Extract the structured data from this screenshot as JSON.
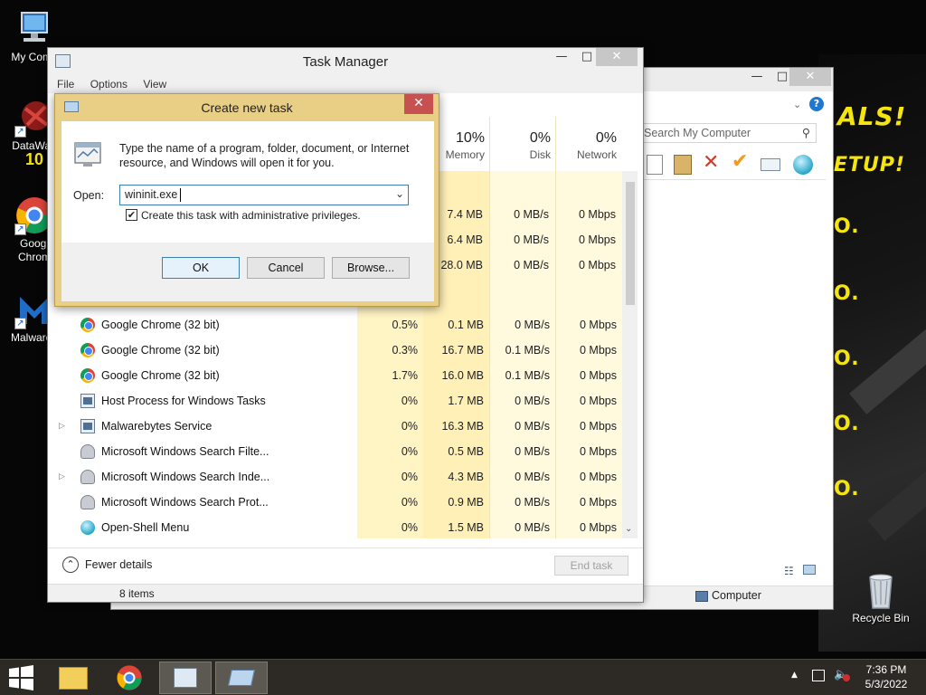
{
  "desktop": {
    "icons": [
      {
        "label": "My Comp"
      },
      {
        "label": "DataWag",
        "sublabel": "10"
      },
      {
        "label": "Googl",
        "sublabel": "Chrom"
      },
      {
        "label": "Malwareb"
      },
      {
        "label": "Recycle Bin"
      }
    ],
    "promo": {
      "deals": "ALS!",
      "setup": "ETUP!",
      "dot": "O."
    }
  },
  "computer_window": {
    "search_placeholder": "Search My Computer",
    "status_item": "Computer",
    "help": "?"
  },
  "task_manager": {
    "title": "Task Manager",
    "menu": [
      "File",
      "Options",
      "View"
    ],
    "columns": [
      {
        "pct": "10%",
        "name": "Memory"
      },
      {
        "pct": "0%",
        "name": "Disk"
      },
      {
        "pct": "0%",
        "name": "Network"
      }
    ],
    "hidden_rows": [
      {
        "mem": "7.4 MB",
        "disk": "0 MB/s",
        "net": "0 Mbps"
      },
      {
        "mem": "6.4 MB",
        "disk": "0 MB/s",
        "net": "0 Mbps"
      },
      {
        "mem": "28.0 MB",
        "disk": "0 MB/s",
        "net": "0 Mbps"
      }
    ],
    "processes": [
      {
        "name": "Google Chrome (32 bit)",
        "icon": "chrome-icon",
        "expand": false,
        "cpu": "0.5%",
        "mem": "0.1 MB",
        "disk": "0 MB/s",
        "net": "0 Mbps"
      },
      {
        "name": "Google Chrome (32 bit)",
        "icon": "chrome-icon",
        "expand": false,
        "cpu": "0.3%",
        "mem": "16.7 MB",
        "disk": "0.1 MB/s",
        "net": "0 Mbps"
      },
      {
        "name": "Google Chrome (32 bit)",
        "icon": "chrome-icon",
        "expand": false,
        "cpu": "1.7%",
        "mem": "16.0 MB",
        "disk": "0.1 MB/s",
        "net": "0 Mbps"
      },
      {
        "name": "Host Process for Windows Tasks",
        "icon": "window-process-icon",
        "expand": false,
        "cpu": "0%",
        "mem": "1.7 MB",
        "disk": "0 MB/s",
        "net": "0 Mbps"
      },
      {
        "name": "Malwarebytes Service",
        "icon": "window-process-icon",
        "expand": true,
        "cpu": "0%",
        "mem": "16.3 MB",
        "disk": "0 MB/s",
        "net": "0 Mbps"
      },
      {
        "name": "Microsoft Windows Search Filte...",
        "icon": "search-process-icon",
        "expand": false,
        "cpu": "0%",
        "mem": "0.5 MB",
        "disk": "0 MB/s",
        "net": "0 Mbps"
      },
      {
        "name": "Microsoft Windows Search Inde...",
        "icon": "search-process-icon",
        "expand": true,
        "cpu": "0%",
        "mem": "4.3 MB",
        "disk": "0 MB/s",
        "net": "0 Mbps"
      },
      {
        "name": "Microsoft Windows Search Prot...",
        "icon": "search-process-icon",
        "expand": false,
        "cpu": "0%",
        "mem": "0.9 MB",
        "disk": "0 MB/s",
        "net": "0 Mbps"
      },
      {
        "name": "Open-Shell Menu",
        "icon": "open-shell-icon",
        "expand": false,
        "cpu": "0%",
        "mem": "1.5 MB",
        "disk": "0 MB/s",
        "net": "0 Mbps"
      }
    ],
    "fewer_details": "Fewer details",
    "end_task": "End task",
    "status_items": "8 items"
  },
  "dialog": {
    "title": "Create new task",
    "description": "Type the name of a program, folder, document, or Internet resource, and Windows will open it for you.",
    "open_label": "Open:",
    "open_value": "wininit.exe",
    "admin_checkbox_label": "Create this task with administrative privileges.",
    "admin_checked": true,
    "ok": "OK",
    "cancel": "Cancel",
    "browse": "Browse..."
  },
  "taskbar": {
    "time": "7:36 PM",
    "date": "5/3/2022"
  },
  "colors": {
    "accent_dialog": "#e9cf85",
    "cpu_col_bg": "#fff4c4",
    "mem_col_bg": "#fff0b8",
    "light_col_bg": "#fff9dd",
    "promo_yellow": "#f5e40d",
    "taskbar": "#2d2a26"
  }
}
